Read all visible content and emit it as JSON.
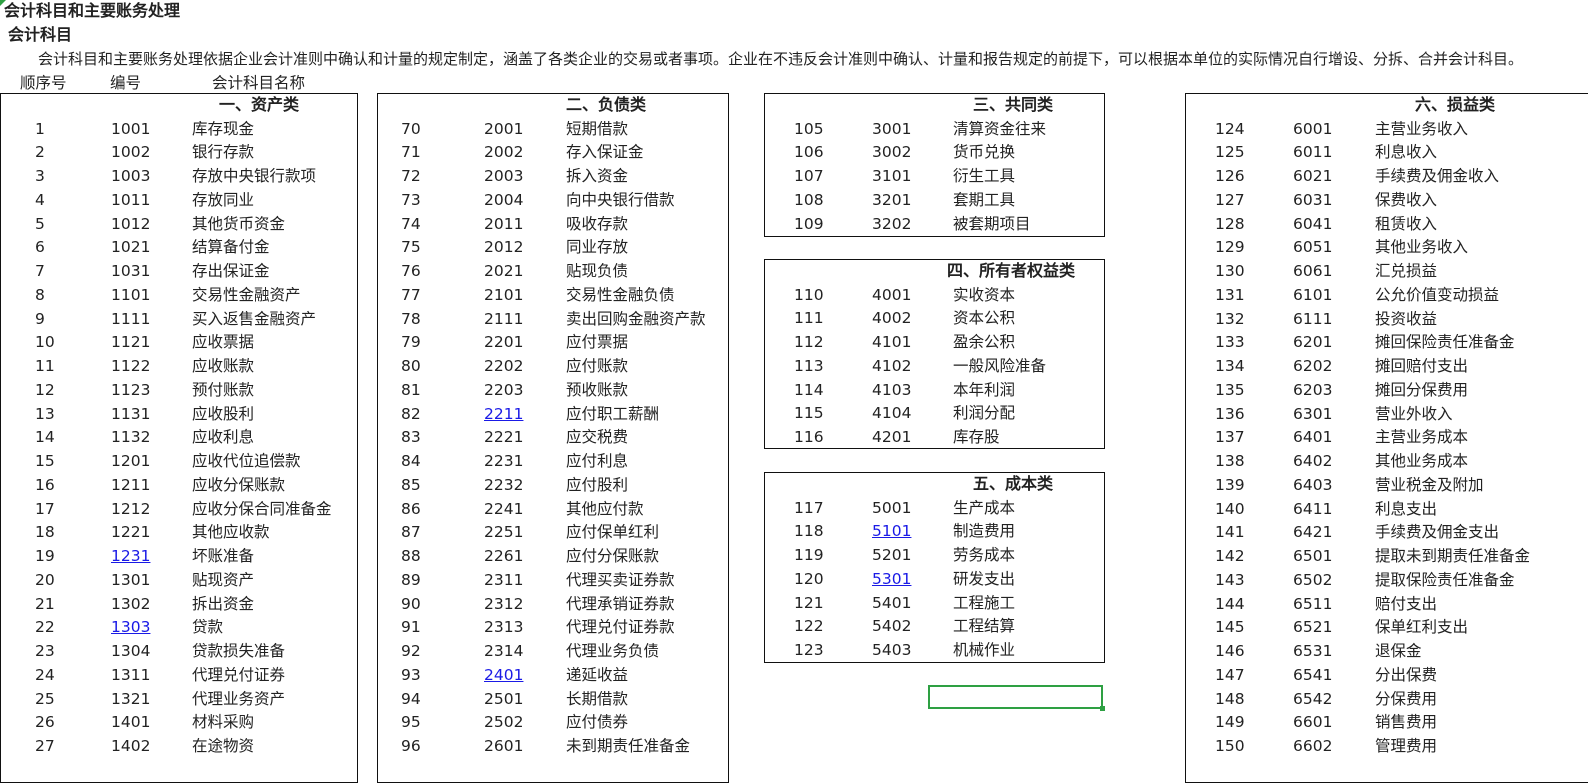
{
  "header": {
    "title": "会计科目和主要账务处理",
    "subtitle": "会计科目",
    "intro": "会计科目和主要账务处理依据企业会计准则中确认和计量的规定制定，涵盖了各类企业的交易或者事项。企业在不违反会计准则中确认、计量和报告规定的前提下，可以根据本单位的实际情况自行增设、分拆、合并会计科目。",
    "col_seq": "顺序号",
    "col_code": "编号",
    "col_name": "会计科目名称"
  },
  "sections": [
    {
      "title": "一、资产类",
      "rows": [
        {
          "seq": "1",
          "code": "1001",
          "name": "库存现金"
        },
        {
          "seq": "2",
          "code": "1002",
          "name": "银行存款"
        },
        {
          "seq": "3",
          "code": "1003",
          "name": "存放中央银行款项"
        },
        {
          "seq": "4",
          "code": "1011",
          "name": "存放同业"
        },
        {
          "seq": "5",
          "code": "1012",
          "name": "其他货币资金"
        },
        {
          "seq": "6",
          "code": "1021",
          "name": "结算备付金"
        },
        {
          "seq": "7",
          "code": "1031",
          "name": "存出保证金"
        },
        {
          "seq": "8",
          "code": "1101",
          "name": "交易性金融资产"
        },
        {
          "seq": "9",
          "code": "1111",
          "name": "买入返售金融资产"
        },
        {
          "seq": "10",
          "code": "1121",
          "name": "应收票据"
        },
        {
          "seq": "11",
          "code": "1122",
          "name": "应收账款"
        },
        {
          "seq": "12",
          "code": "1123",
          "name": "预付账款"
        },
        {
          "seq": "13",
          "code": "1131",
          "name": "应收股利"
        },
        {
          "seq": "14",
          "code": "1132",
          "name": "应收利息"
        },
        {
          "seq": "15",
          "code": "1201",
          "name": "应收代位追偿款"
        },
        {
          "seq": "16",
          "code": "1211",
          "name": "应收分保账款"
        },
        {
          "seq": "17",
          "code": "1212",
          "name": "应收分保合同准备金"
        },
        {
          "seq": "18",
          "code": "1221",
          "name": "其他应收款"
        },
        {
          "seq": "19",
          "code": "1231",
          "name": "坏账准备",
          "link": true
        },
        {
          "seq": "20",
          "code": "1301",
          "name": "贴现资产"
        },
        {
          "seq": "21",
          "code": "1302",
          "name": "拆出资金"
        },
        {
          "seq": "22",
          "code": "1303",
          "name": "贷款",
          "link": true
        },
        {
          "seq": "23",
          "code": "1304",
          "name": "贷款损失准备"
        },
        {
          "seq": "24",
          "code": "1311",
          "name": "代理兑付证券"
        },
        {
          "seq": "25",
          "code": "1321",
          "name": "代理业务资产"
        },
        {
          "seq": "26",
          "code": "1401",
          "name": "材料采购"
        },
        {
          "seq": "27",
          "code": "1402",
          "name": "在途物资"
        }
      ]
    },
    {
      "title": "二、负债类",
      "rows": [
        {
          "seq": "70",
          "code": "2001",
          "name": "短期借款"
        },
        {
          "seq": "71",
          "code": "2002",
          "name": "存入保证金"
        },
        {
          "seq": "72",
          "code": "2003",
          "name": "拆入资金"
        },
        {
          "seq": "73",
          "code": "2004",
          "name": "向中央银行借款"
        },
        {
          "seq": "74",
          "code": "2011",
          "name": "吸收存款"
        },
        {
          "seq": "75",
          "code": "2012",
          "name": "同业存放"
        },
        {
          "seq": "76",
          "code": "2021",
          "name": "贴现负债"
        },
        {
          "seq": "77",
          "code": "2101",
          "name": "交易性金融负债"
        },
        {
          "seq": "78",
          "code": "2111",
          "name": "卖出回购金融资产款"
        },
        {
          "seq": "79",
          "code": "2201",
          "name": "应付票据"
        },
        {
          "seq": "80",
          "code": "2202",
          "name": "应付账款"
        },
        {
          "seq": "81",
          "code": "2203",
          "name": "预收账款"
        },
        {
          "seq": "82",
          "code": "2211",
          "name": "应付职工薪酬",
          "link": true
        },
        {
          "seq": "83",
          "code": "2221",
          "name": "应交税费"
        },
        {
          "seq": "84",
          "code": "2231",
          "name": "应付利息"
        },
        {
          "seq": "85",
          "code": "2232",
          "name": "应付股利"
        },
        {
          "seq": "86",
          "code": "2241",
          "name": "其他应付款"
        },
        {
          "seq": "87",
          "code": "2251",
          "name": "应付保单红利"
        },
        {
          "seq": "88",
          "code": "2261",
          "name": "应付分保账款"
        },
        {
          "seq": "89",
          "code": "2311",
          "name": "代理买卖证券款"
        },
        {
          "seq": "90",
          "code": "2312",
          "name": "代理承销证券款"
        },
        {
          "seq": "91",
          "code": "2313",
          "name": "代理兑付证券款"
        },
        {
          "seq": "92",
          "code": "2314",
          "name": "代理业务负债"
        },
        {
          "seq": "93",
          "code": "2401",
          "name": "递延收益",
          "link": true
        },
        {
          "seq": "94",
          "code": "2501",
          "name": "长期借款"
        },
        {
          "seq": "95",
          "code": "2502",
          "name": "应付债券"
        },
        {
          "seq": "96",
          "code": "2601",
          "name": "未到期责任准备金"
        }
      ]
    },
    {
      "title": "三、共同类",
      "rows": [
        {
          "seq": "105",
          "code": "3001",
          "name": "清算资金往来"
        },
        {
          "seq": "106",
          "code": "3002",
          "name": "货币兑换"
        },
        {
          "seq": "107",
          "code": "3101",
          "name": "衍生工具"
        },
        {
          "seq": "108",
          "code": "3201",
          "name": "套期工具"
        },
        {
          "seq": "109",
          "code": "3202",
          "name": "被套期项目"
        }
      ]
    },
    {
      "title": "四、所有者权益类",
      "rows": [
        {
          "seq": "110",
          "code": "4001",
          "name": "实收资本"
        },
        {
          "seq": "111",
          "code": "4002",
          "name": "资本公积"
        },
        {
          "seq": "112",
          "code": "4101",
          "name": "盈余公积"
        },
        {
          "seq": "113",
          "code": "4102",
          "name": "一般风险准备"
        },
        {
          "seq": "114",
          "code": "4103",
          "name": "本年利润"
        },
        {
          "seq": "115",
          "code": "4104",
          "name": "利润分配"
        },
        {
          "seq": "116",
          "code": "4201",
          "name": "库存股"
        }
      ]
    },
    {
      "title": "五、成本类",
      "rows": [
        {
          "seq": "117",
          "code": "5001",
          "name": "生产成本"
        },
        {
          "seq": "118",
          "code": "5101",
          "name": "制造费用",
          "link": true
        },
        {
          "seq": "119",
          "code": "5201",
          "name": "劳务成本"
        },
        {
          "seq": "120",
          "code": "5301",
          "name": "研发支出",
          "link": true
        },
        {
          "seq": "121",
          "code": "5401",
          "name": "工程施工"
        },
        {
          "seq": "122",
          "code": "5402",
          "name": "工程结算"
        },
        {
          "seq": "123",
          "code": "5403",
          "name": "机械作业"
        }
      ]
    },
    {
      "title": "六、损益类",
      "rows": [
        {
          "seq": "124",
          "code": "6001",
          "name": "主营业务收入"
        },
        {
          "seq": "125",
          "code": "6011",
          "name": "利息收入"
        },
        {
          "seq": "126",
          "code": "6021",
          "name": "手续费及佣金收入"
        },
        {
          "seq": "127",
          "code": "6031",
          "name": "保费收入"
        },
        {
          "seq": "128",
          "code": "6041",
          "name": "租赁收入"
        },
        {
          "seq": "129",
          "code": "6051",
          "name": "其他业务收入"
        },
        {
          "seq": "130",
          "code": "6061",
          "name": "汇兑损益"
        },
        {
          "seq": "131",
          "code": "6101",
          "name": "公允价值变动损益"
        },
        {
          "seq": "132",
          "code": "6111",
          "name": "投资收益"
        },
        {
          "seq": "133",
          "code": "6201",
          "name": "摊回保险责任准备金"
        },
        {
          "seq": "134",
          "code": "6202",
          "name": "摊回赔付支出"
        },
        {
          "seq": "135",
          "code": "6203",
          "name": "摊回分保费用"
        },
        {
          "seq": "136",
          "code": "6301",
          "name": "营业外收入"
        },
        {
          "seq": "137",
          "code": "6401",
          "name": "主营业务成本"
        },
        {
          "seq": "138",
          "code": "6402",
          "name": "其他业务成本"
        },
        {
          "seq": "139",
          "code": "6403",
          "name": "营业税金及附加"
        },
        {
          "seq": "140",
          "code": "6411",
          "name": "利息支出"
        },
        {
          "seq": "141",
          "code": "6421",
          "name": "手续费及佣金支出"
        },
        {
          "seq": "142",
          "code": "6501",
          "name": "提取未到期责任准备金"
        },
        {
          "seq": "143",
          "code": "6502",
          "name": "提取保险责任准备金"
        },
        {
          "seq": "144",
          "code": "6511",
          "name": "赔付支出"
        },
        {
          "seq": "145",
          "code": "6521",
          "name": "保单红利支出"
        },
        {
          "seq": "146",
          "code": "6531",
          "name": "退保金"
        },
        {
          "seq": "147",
          "code": "6541",
          "name": "分出保费"
        },
        {
          "seq": "148",
          "code": "6542",
          "name": "分保费用"
        },
        {
          "seq": "149",
          "code": "6601",
          "name": "销售费用"
        },
        {
          "seq": "150",
          "code": "6602",
          "name": "管理费用"
        }
      ]
    }
  ],
  "colors": {
    "link": "#1a1ae6",
    "selection": "#2ea043",
    "border": "#111111"
  }
}
